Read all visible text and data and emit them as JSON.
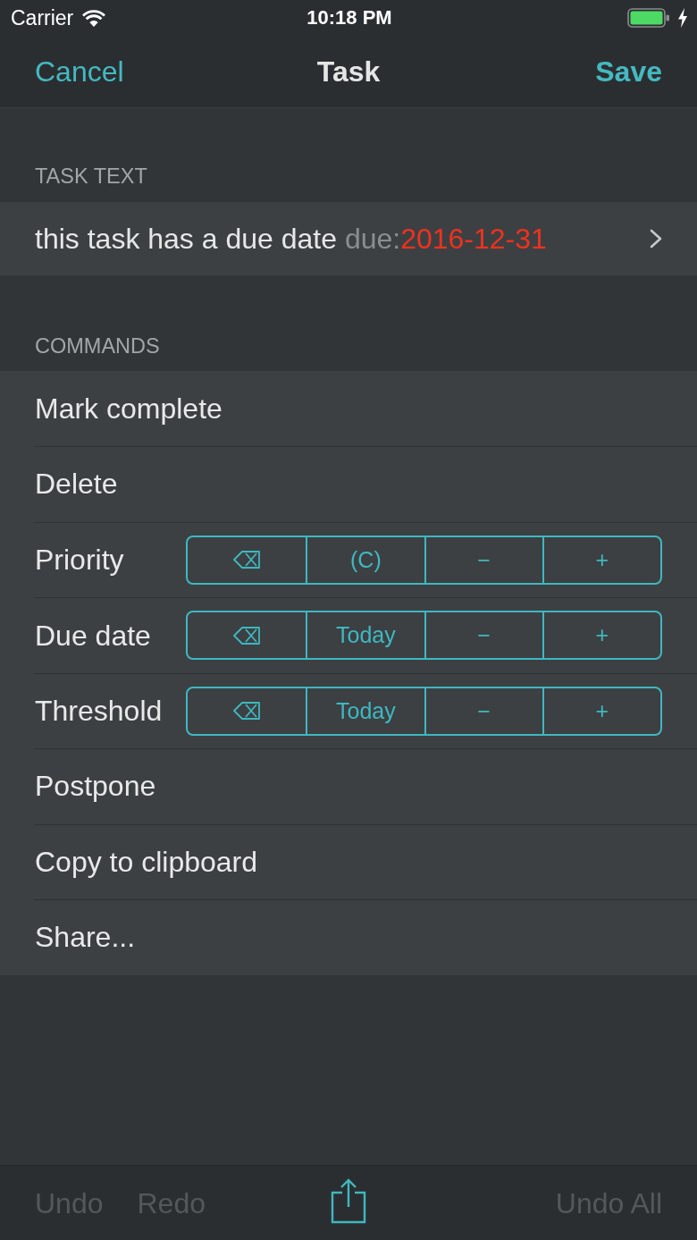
{
  "status_bar": {
    "carrier": "Carrier",
    "time": "10:18 PM"
  },
  "nav_bar": {
    "cancel": "Cancel",
    "title": "Task",
    "save": "Save"
  },
  "task_text": {
    "header": "TASK TEXT",
    "parts": [
      {
        "kind": "plain",
        "text": "this task has a due date "
      },
      {
        "kind": "key",
        "text": "due:"
      },
      {
        "kind": "overdue",
        "text": "2016-12-31"
      }
    ]
  },
  "commands": {
    "header": "COMMANDS",
    "rows": [
      {
        "kind": "action",
        "label": "Mark complete"
      },
      {
        "kind": "action",
        "label": "Delete"
      },
      {
        "kind": "stepper",
        "label": "Priority",
        "segments": [
          {
            "kind": "clear"
          },
          {
            "kind": "text",
            "label": "(C)"
          },
          {
            "kind": "text",
            "label": "−"
          },
          {
            "kind": "text",
            "label": "+"
          }
        ]
      },
      {
        "kind": "stepper",
        "label": "Due date",
        "segments": [
          {
            "kind": "clear"
          },
          {
            "kind": "text",
            "label": "Today"
          },
          {
            "kind": "text",
            "label": "−"
          },
          {
            "kind": "text",
            "label": "+"
          }
        ]
      },
      {
        "kind": "stepper",
        "label": "Threshold",
        "segments": [
          {
            "kind": "clear"
          },
          {
            "kind": "text",
            "label": "Today"
          },
          {
            "kind": "text",
            "label": "−"
          },
          {
            "kind": "text",
            "label": "+"
          }
        ]
      },
      {
        "kind": "action",
        "label": "Postpone"
      },
      {
        "kind": "action",
        "label": "Copy to clipboard"
      },
      {
        "kind": "action",
        "label": "Share..."
      }
    ]
  },
  "toolbar": {
    "items": [
      {
        "kind": "text",
        "label": "Undo",
        "disabled": true
      },
      {
        "kind": "text",
        "label": "Redo",
        "disabled": true
      },
      {
        "kind": "share",
        "disabled": false
      },
      {
        "kind": "text",
        "label": "Undo All",
        "disabled": true
      }
    ]
  }
}
